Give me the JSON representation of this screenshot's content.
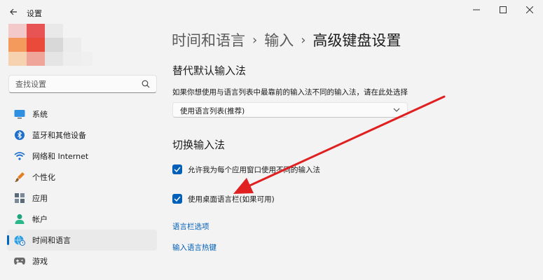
{
  "window": {
    "app_title": "设置",
    "controls": {
      "minimize": "—",
      "maximize": "☐",
      "close": "✕"
    }
  },
  "search": {
    "placeholder": "查找设置"
  },
  "sidebar": {
    "items": [
      {
        "label": "系统",
        "icon": "monitor-icon",
        "active": false
      },
      {
        "label": "蓝牙和其他设备",
        "icon": "bluetooth-icon",
        "active": false
      },
      {
        "label": "网络和 Internet",
        "icon": "wifi-icon",
        "active": false
      },
      {
        "label": "个性化",
        "icon": "brush-icon",
        "active": false
      },
      {
        "label": "应用",
        "icon": "apps-icon",
        "active": false
      },
      {
        "label": "帐户",
        "icon": "person-icon",
        "active": false
      },
      {
        "label": "时间和语言",
        "icon": "globe-clock-icon",
        "active": true
      },
      {
        "label": "游戏",
        "icon": "gamepad-icon",
        "active": false
      }
    ]
  },
  "breadcrumb": {
    "parts": [
      "时间和语言",
      "输入",
      "高级键盘设置"
    ],
    "separator": "›"
  },
  "default_input": {
    "title": "替代默认输入法",
    "description": "如果你想使用与语言列表中最靠前的输入法不同的输入法，请在此处选择",
    "dropdown_value": "使用语言列表(推荐)"
  },
  "switch_input": {
    "title": "切换输入法",
    "options": [
      {
        "label": "允许我为每个应用窗口使用不同的输入法",
        "checked": true
      },
      {
        "label": "使用桌面语言栏(如果可用)",
        "checked": true
      }
    ]
  },
  "links": {
    "language_bar_options": "语言栏选项",
    "input_hotkeys": "输入语言热键"
  },
  "colors": {
    "accent": "#005fb8",
    "annotation_arrow": "#e02020"
  }
}
